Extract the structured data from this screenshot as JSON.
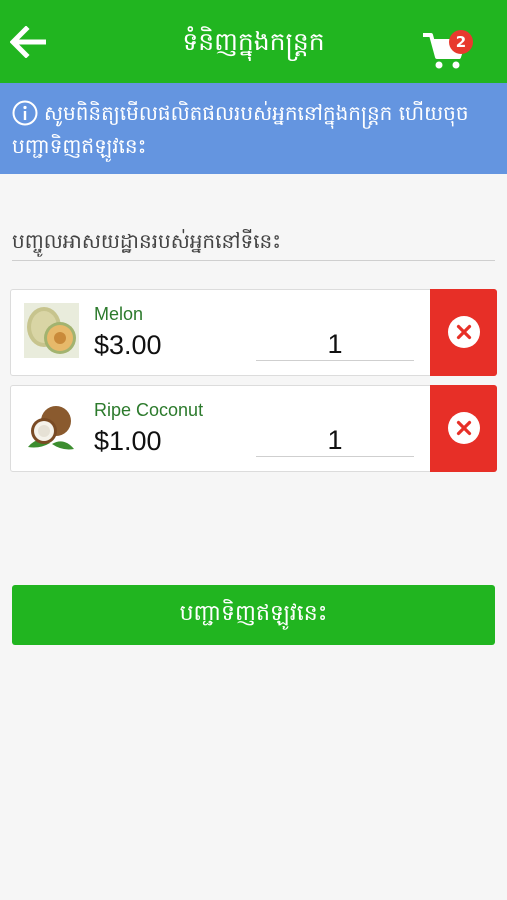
{
  "header": {
    "title": "ទំនិញក្នុងកន្ត្រក",
    "cart_count": "2",
    "back_icon": "arrow-left-icon",
    "cart_icon": "shopping-cart-icon"
  },
  "info": {
    "icon": "info-icon",
    "text": "សូមពិនិត្យមើលផលិតផលរបស់អ្នកនៅក្នុងកន្ត្រក ហើយចុចបញ្ជាទិញឥឡូវនេះ"
  },
  "address": {
    "placeholder": "បញ្ចូលអាសយដ្ឋានរបស់អ្នកនៅទីនេះ",
    "value": ""
  },
  "cart_items": [
    {
      "name": "Melon",
      "price": "$3.00",
      "quantity": "1",
      "image_icon": "melon-image"
    },
    {
      "name": "Ripe Coconut",
      "price": "$1.00",
      "quantity": "1",
      "image_icon": "coconut-image"
    }
  ],
  "submit_label": "បញ្ជាទិញឥឡូវនេះ",
  "colors": {
    "primary_green": "#21b520",
    "info_blue": "#6495e0",
    "remove_red": "#e72f27",
    "badge_red": "#e8392e"
  }
}
